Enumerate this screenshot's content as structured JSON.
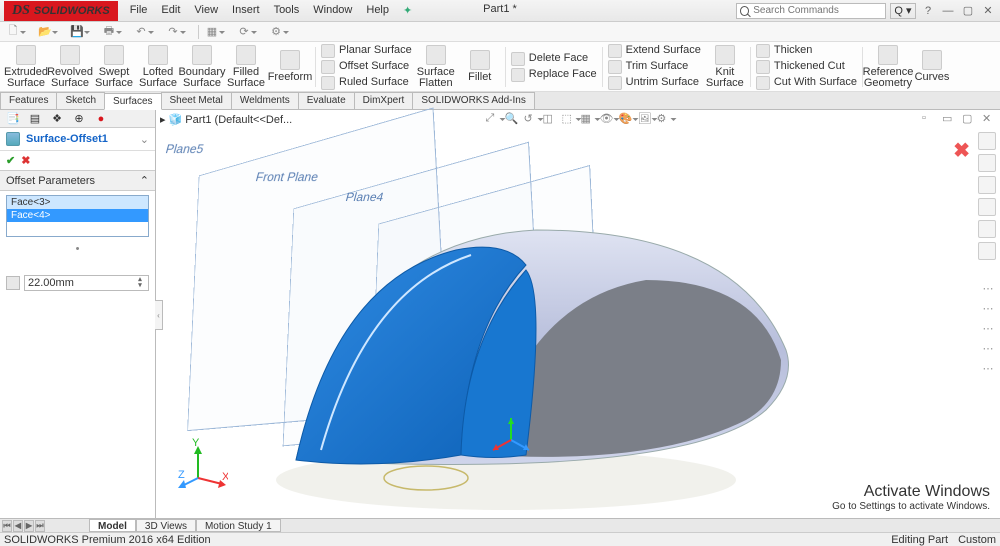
{
  "app": {
    "brand": "SOLIDWORKS"
  },
  "menu": {
    "file": "File",
    "edit": "Edit",
    "view": "View",
    "insert": "Insert",
    "tools": "Tools",
    "window": "Window",
    "help": "Help"
  },
  "title": "Part1 *",
  "search": {
    "placeholder": "Search Commands"
  },
  "ribbon": {
    "extruded": "Extruded Surface",
    "revolved": "Revolved Surface",
    "swept": "Swept Surface",
    "lofted": "Lofted Surface",
    "boundary": "Boundary Surface",
    "filled": "Filled Surface",
    "freeform": "Freeform",
    "planar": "Planar Surface",
    "offset": "Offset Surface",
    "ruled": "Ruled Surface",
    "flatten": "Surface Flatten",
    "fillet": "Fillet",
    "deleteface": "Delete Face",
    "replaceface": "Replace Face",
    "extend": "Extend Surface",
    "trim": "Trim Surface",
    "untrim": "Untrim Surface",
    "knit": "Knit Surface",
    "thicken": "Thicken",
    "thickcut": "Thickened Cut",
    "cutwith": "Cut With Surface",
    "refgeom": "Reference Geometry",
    "curves": "Curves"
  },
  "tabs": {
    "features": "Features",
    "sketch": "Sketch",
    "surfaces": "Surfaces",
    "sheetmetal": "Sheet Metal",
    "weldments": "Weldments",
    "evaluate": "Evaluate",
    "dimxpert": "DimXpert",
    "addins": "SOLIDWORKS Add-Ins"
  },
  "pm": {
    "title": "Surface-Offset1",
    "section": "Offset Parameters",
    "face1": "Face<3>",
    "face2": "Face<4>",
    "dist": "22.00mm"
  },
  "breadcrumb": {
    "part": "Part1",
    "config": "(Default<<Def..."
  },
  "planes": {
    "p5": "Plane5",
    "front": "Front Plane",
    "p4": "Plane4"
  },
  "watermark": {
    "t": "Activate Windows",
    "s": "Go to Settings to activate Windows."
  },
  "btabs": {
    "model": "Model",
    "views": "3D Views",
    "motion": "Motion Study 1"
  },
  "status": {
    "left": "SOLIDWORKS Premium 2016 x64 Edition",
    "edit": "Editing Part",
    "custom": "Custom"
  }
}
